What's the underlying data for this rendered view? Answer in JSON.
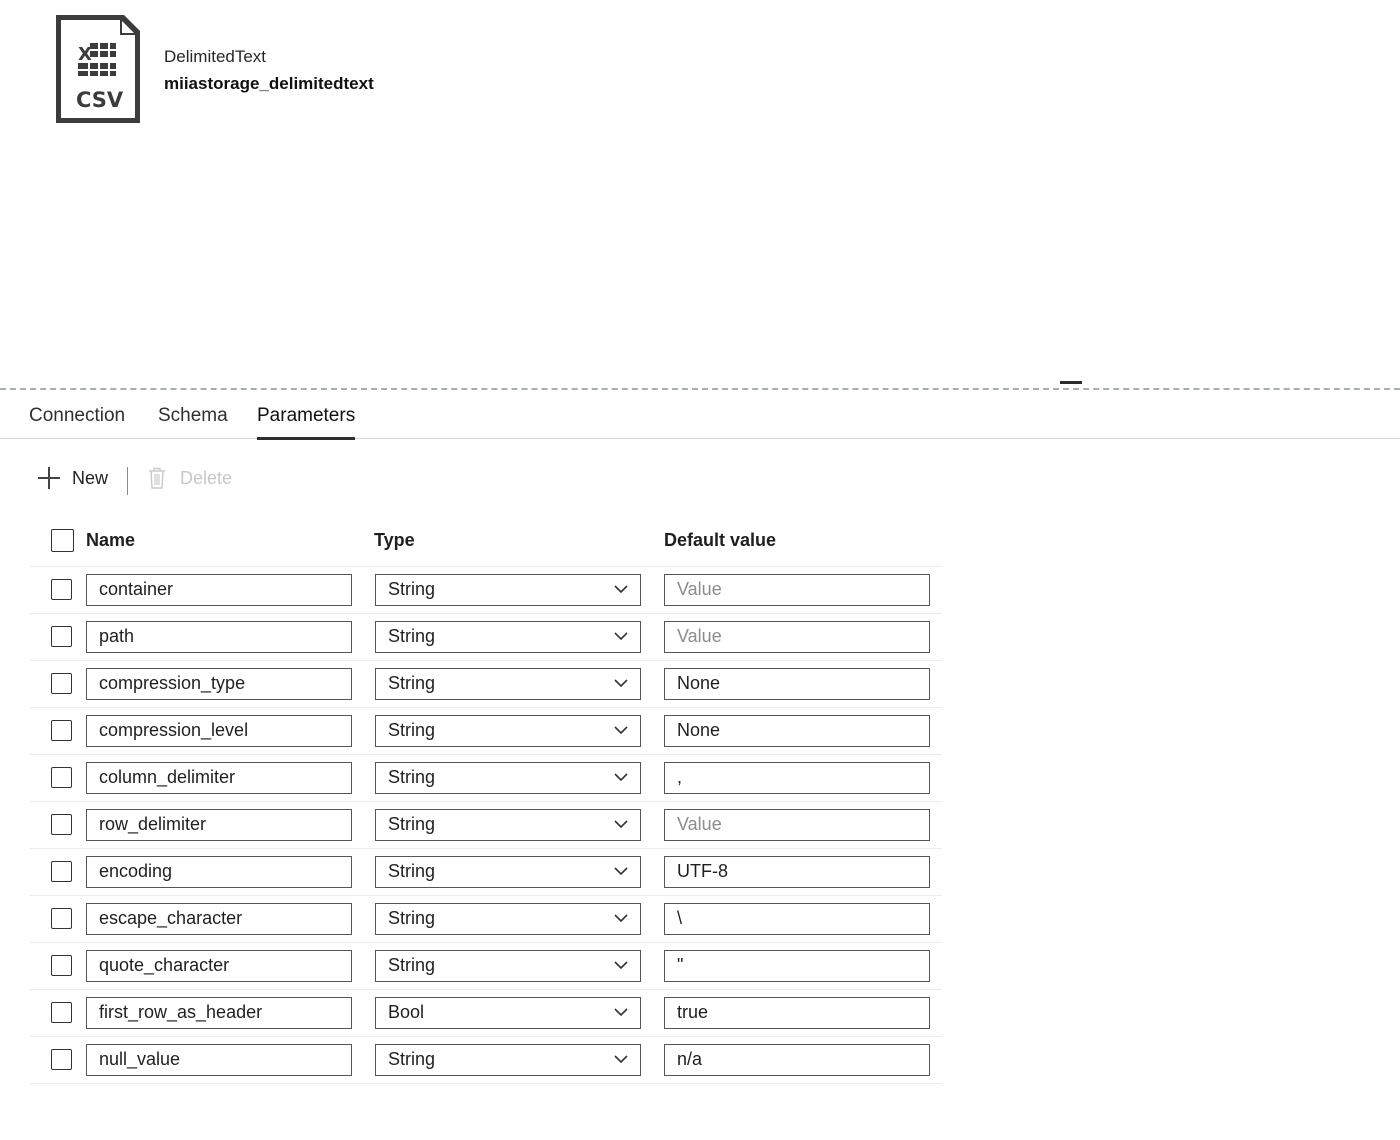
{
  "header": {
    "icon": "csv-file-icon",
    "icon_label": "CSV",
    "type_label": "DelimitedText",
    "dataset_name": "miiastorage_delimitedtext"
  },
  "tabs": [
    {
      "label": "Connection",
      "active": false
    },
    {
      "label": "Schema",
      "active": false
    },
    {
      "label": "Parameters",
      "active": true
    }
  ],
  "toolbar": {
    "new_label": "New",
    "delete_label": "Delete",
    "delete_disabled": true
  },
  "table": {
    "columns": {
      "name": "Name",
      "type": "Type",
      "default": "Default value"
    },
    "default_placeholder": "Value",
    "rows": [
      {
        "name": "container",
        "type": "String",
        "default": "",
        "default_display": "Value"
      },
      {
        "name": "path",
        "type": "String",
        "default": "",
        "default_display": "Value"
      },
      {
        "name": "compression_type",
        "type": "String",
        "default": "None",
        "default_display": "None"
      },
      {
        "name": "compression_level",
        "type": "String",
        "default": "None",
        "default_display": "None"
      },
      {
        "name": "column_delimiter",
        "type": "String",
        "default": ",",
        "default_display": ","
      },
      {
        "name": "row_delimiter",
        "type": "String",
        "default": "",
        "default_display": "Value"
      },
      {
        "name": "encoding",
        "type": "String",
        "default": "UTF-8",
        "default_display": "UTF-8"
      },
      {
        "name": "escape_character",
        "type": "String",
        "default": "\\",
        "default_display": "\\"
      },
      {
        "name": "quote_character",
        "type": "String",
        "default": "\"",
        "default_display": "\""
      },
      {
        "name": "first_row_as_header",
        "type": "Bool",
        "default": "true",
        "default_display": "true"
      },
      {
        "name": "null_value",
        "type": "String",
        "default": "n/a",
        "default_display": "n/a"
      }
    ]
  },
  "colors": {
    "tab_active_underline": "#2f2f2f",
    "placeholder_text": "#8c8c8c",
    "disabled_text": "#c8c8c8",
    "splitter_dash": "#a8acb3"
  }
}
